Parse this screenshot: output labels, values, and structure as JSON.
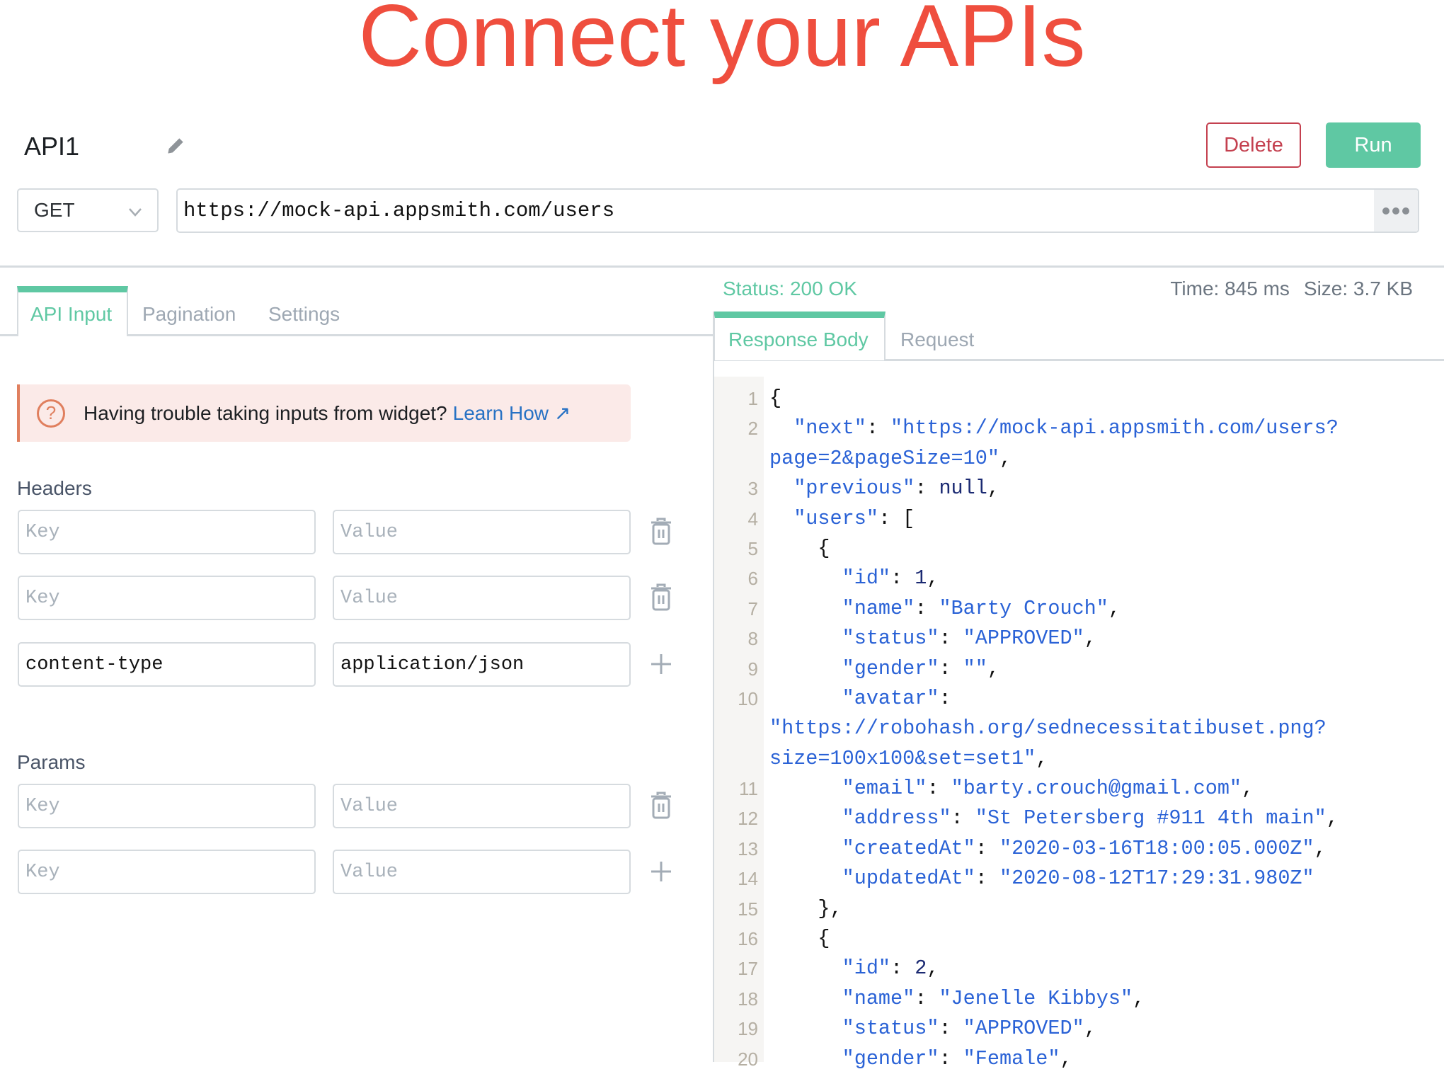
{
  "hero_title": "Connect your APIs",
  "api": {
    "name": "API1",
    "delete_label": "Delete",
    "run_label": "Run",
    "method": "GET",
    "url": "https://mock-api.appsmith.com/users"
  },
  "left_tabs": [
    {
      "label": "API Input",
      "active": true
    },
    {
      "label": "Pagination",
      "active": false
    },
    {
      "label": "Settings",
      "active": false
    }
  ],
  "callout": {
    "text": "Having trouble taking inputs from widget?",
    "link": "Learn How"
  },
  "headers": {
    "label": "Headers",
    "rows": [
      {
        "key": "",
        "value": "",
        "key_placeholder": "Key",
        "value_placeholder": "Value",
        "action": "trash-icon"
      },
      {
        "key": "",
        "value": "",
        "key_placeholder": "Key",
        "value_placeholder": "Value",
        "action": "trash-icon"
      },
      {
        "key": "content-type",
        "value": "application/json",
        "key_placeholder": "Key",
        "value_placeholder": "Value",
        "action": "plus-icon"
      }
    ]
  },
  "params": {
    "label": "Params",
    "rows": [
      {
        "key": "",
        "value": "",
        "key_placeholder": "Key",
        "value_placeholder": "Value",
        "action": "trash-icon"
      },
      {
        "key": "",
        "value": "",
        "key_placeholder": "Key",
        "value_placeholder": "Value",
        "action": "plus-icon"
      }
    ]
  },
  "response": {
    "status": "Status: 200 OK",
    "time": "Time: 845 ms",
    "size": "Size: 3.7 KB",
    "tabs": [
      {
        "label": "Response Body",
        "active": true
      },
      {
        "label": "Request",
        "active": false
      }
    ],
    "lines": [
      {
        "n": "1",
        "t": [
          [
            "{",
            "p"
          ]
        ]
      },
      {
        "n": "2",
        "t": [
          [
            "  \"next\"",
            "key"
          ],
          [
            ": ",
            "p"
          ],
          [
            "\"https://mock-api.appsmith.com/users?",
            "str"
          ]
        ]
      },
      {
        "n": "",
        "t": [
          [
            "page=2&pageSize=10\"",
            "str"
          ],
          [
            ",",
            "p"
          ]
        ]
      },
      {
        "n": "3",
        "t": [
          [
            "  \"previous\"",
            "key"
          ],
          [
            ": ",
            "p"
          ],
          [
            "null",
            "lit"
          ],
          [
            ",",
            "p"
          ]
        ]
      },
      {
        "n": "4",
        "t": [
          [
            "  \"users\"",
            "key"
          ],
          [
            ": [",
            "p"
          ]
        ]
      },
      {
        "n": "5",
        "t": [
          [
            "    {",
            "p"
          ]
        ]
      },
      {
        "n": "6",
        "t": [
          [
            "      \"id\"",
            "key"
          ],
          [
            ": ",
            "p"
          ],
          [
            "1",
            "lit"
          ],
          [
            ",",
            "p"
          ]
        ]
      },
      {
        "n": "7",
        "t": [
          [
            "      \"name\"",
            "key"
          ],
          [
            ": ",
            "p"
          ],
          [
            "\"Barty Crouch\"",
            "str"
          ],
          [
            ",",
            "p"
          ]
        ]
      },
      {
        "n": "8",
        "t": [
          [
            "      \"status\"",
            "key"
          ],
          [
            ": ",
            "p"
          ],
          [
            "\"APPROVED\"",
            "str"
          ],
          [
            ",",
            "p"
          ]
        ]
      },
      {
        "n": "9",
        "t": [
          [
            "      \"gender\"",
            "key"
          ],
          [
            ": ",
            "p"
          ],
          [
            "\"\"",
            "str"
          ],
          [
            ",",
            "p"
          ]
        ]
      },
      {
        "n": "10",
        "t": [
          [
            "      \"avatar\"",
            "key"
          ],
          [
            ":",
            "p"
          ]
        ]
      },
      {
        "n": "",
        "t": [
          [
            "\"https://robohash.org/sednecessitatibuset.png?",
            "str"
          ]
        ]
      },
      {
        "n": "",
        "t": [
          [
            "size=100x100&set=set1\"",
            "str"
          ],
          [
            ",",
            "p"
          ]
        ]
      },
      {
        "n": "11",
        "t": [
          [
            "      \"email\"",
            "key"
          ],
          [
            ": ",
            "p"
          ],
          [
            "\"barty.crouch@gmail.com\"",
            "str"
          ],
          [
            ",",
            "p"
          ]
        ]
      },
      {
        "n": "12",
        "t": [
          [
            "      \"address\"",
            "key"
          ],
          [
            ": ",
            "p"
          ],
          [
            "\"St Petersberg #911 4th main\"",
            "str"
          ],
          [
            ",",
            "p"
          ]
        ]
      },
      {
        "n": "13",
        "t": [
          [
            "      \"createdAt\"",
            "key"
          ],
          [
            ": ",
            "p"
          ],
          [
            "\"2020-03-16T18:00:05.000Z\"",
            "str"
          ],
          [
            ",",
            "p"
          ]
        ]
      },
      {
        "n": "14",
        "t": [
          [
            "      \"updatedAt\"",
            "key"
          ],
          [
            ": ",
            "p"
          ],
          [
            "\"2020-08-12T17:29:31.980Z\"",
            "str"
          ]
        ]
      },
      {
        "n": "15",
        "t": [
          [
            "    },",
            "p"
          ]
        ]
      },
      {
        "n": "16",
        "t": [
          [
            "    {",
            "p"
          ]
        ]
      },
      {
        "n": "17",
        "t": [
          [
            "      \"id\"",
            "key"
          ],
          [
            ": ",
            "p"
          ],
          [
            "2",
            "lit"
          ],
          [
            ",",
            "p"
          ]
        ]
      },
      {
        "n": "18",
        "t": [
          [
            "      \"name\"",
            "key"
          ],
          [
            ": ",
            "p"
          ],
          [
            "\"Jenelle Kibbys\"",
            "str"
          ],
          [
            ",",
            "p"
          ]
        ]
      },
      {
        "n": "19",
        "t": [
          [
            "      \"status\"",
            "key"
          ],
          [
            ": ",
            "p"
          ],
          [
            "\"APPROVED\"",
            "str"
          ],
          [
            ",",
            "p"
          ]
        ]
      },
      {
        "n": "20",
        "t": [
          [
            "      \"gender\"",
            "key"
          ],
          [
            ": ",
            "p"
          ],
          [
            "\"Female\"",
            "str"
          ],
          [
            ",",
            "p"
          ]
        ]
      }
    ]
  },
  "colors": {
    "accent": "#5fc8a3",
    "danger": "#c4404f",
    "hero": "#ef4e3e",
    "link": "#2872c4"
  }
}
